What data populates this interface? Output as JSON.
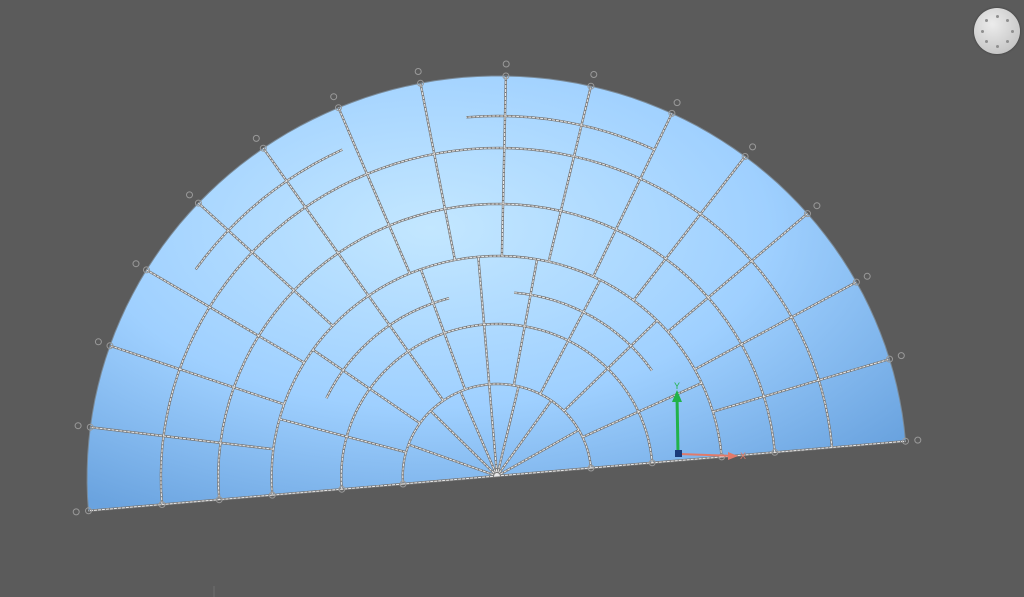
{
  "viewport": {
    "background": "#5b5b5b",
    "surface_color_light": "#bfe4ff",
    "surface_color_dark": "#6ea6e2",
    "mesh_line_color": "#e8e8e8",
    "mesh_line_shadow": "#777777",
    "control_point_color": "#9a9a9a"
  },
  "view_navigator": {
    "icon": "view-cube-icon"
  },
  "axis_triad": {
    "y_label": "Y",
    "x_label": "X",
    "y_color": "#21b24a",
    "x_color": "#e07a6a",
    "origin_color": "#1a3a7a"
  }
}
